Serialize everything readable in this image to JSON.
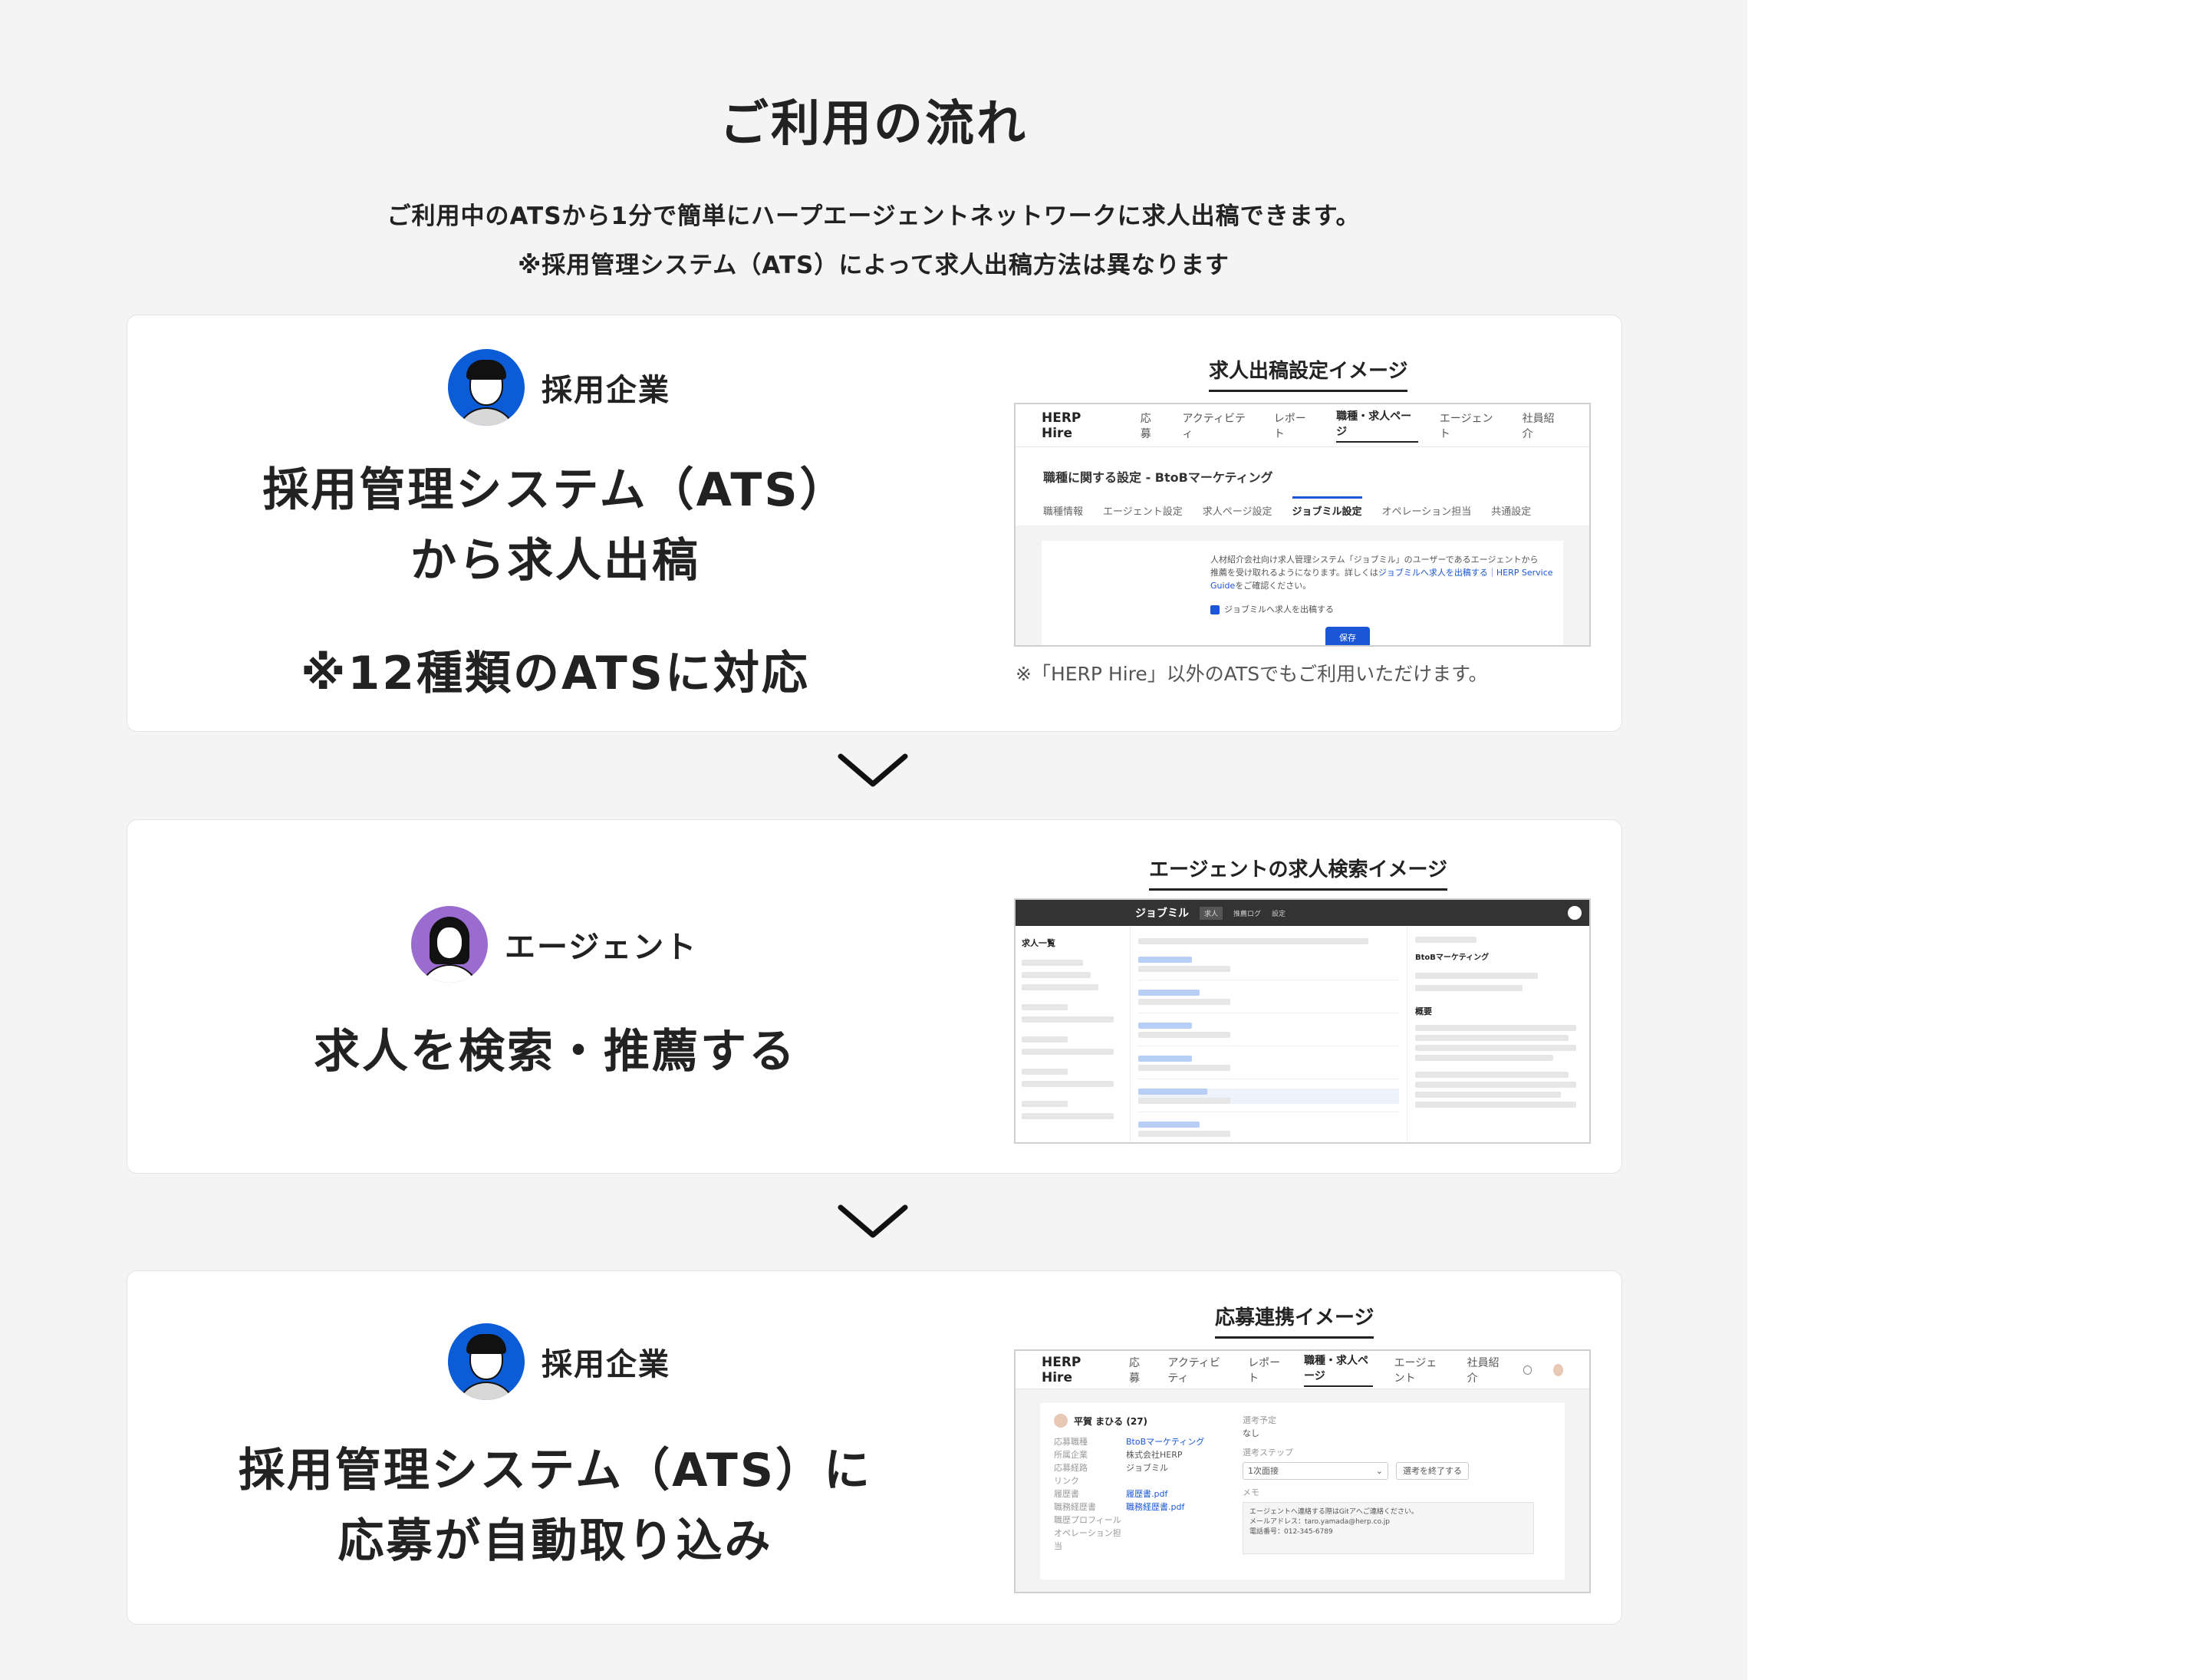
{
  "page": {
    "title": "ご利用の流れ",
    "subtitle_1": "ご利用中のATSから1分で簡単にハープエージェントネットワークに求人出稿できます。",
    "subtitle_2": "※採用管理システム（ATS）によって求人出稿方法は異なります"
  },
  "steps": [
    {
      "role": "採用企業",
      "headline_1": "採用管理システム（ATS）",
      "headline_2": "から求人出稿",
      "note": "※12種類のATSに対応",
      "caption": "求人出稿設定イメージ",
      "footnote": "※「HERP Hire」以外のATSでもご利用いただけます。",
      "screenshot": {
        "logo": "HERP Hire",
        "nav": [
          "応募",
          "アクティビティ",
          "レポート",
          "職種・求人ページ",
          "エージェント",
          "社員紹介"
        ],
        "active_nav": "職種・求人ページ",
        "heading": "職種に関する設定 - BtoBマーケティング",
        "tabs": [
          "職種情報",
          "エージェント設定",
          "求人ページ設定",
          "ジョブミル設定",
          "オペレーション担当",
          "共通設定"
        ],
        "active_tab": "ジョブミル設定",
        "body_1": "人材紹介会社向け求人管理システム「ジョブミル」のユーザーであるエージェントから",
        "body_2": "推薦を受け取れるようになります。詳しくは",
        "body_link": "ジョブミルへ求人を出稿する｜HERP Service Guide",
        "body_3": "をご確認ください。",
        "checkbox_label": "ジョブミルへ求人を出稿する",
        "save_button": "保存"
      }
    },
    {
      "role": "エージェント",
      "headline_1": "求人を検索・推薦する",
      "caption": "エージェントの求人検索イメージ",
      "screenshot": {
        "brand": "ジョブミル",
        "tabs": [
          "求人",
          "推薦ログ",
          "設定"
        ],
        "side_title": "求人一覧",
        "detail_section": "概要",
        "detail_title": "BtoBマーケティング"
      }
    },
    {
      "role": "採用企業",
      "headline_1": "採用管理システム（ATS）に",
      "headline_2": "応募が自動取り込み",
      "caption": "応募連携イメージ",
      "screenshot": {
        "logo": "HERP Hire",
        "nav": [
          "応募",
          "アクティビティ",
          "レポート",
          "職種・求人ページ",
          "エージェント",
          "社員紹介"
        ],
        "active_nav": "職種・求人ページ",
        "candidate": "平賀 まひる (27)",
        "fields": [
          {
            "label": "応募職種",
            "value": "BtoBマーケティング"
          },
          {
            "label": "所属企業",
            "value": "株式会社HERP"
          },
          {
            "label": "応募経路",
            "value": "ジョブミル"
          },
          {
            "label": "リンク",
            "value": ""
          },
          {
            "label": "履歴書",
            "value": "履歴書.pdf"
          },
          {
            "label": "職務経歴書",
            "value": "職務経歴書.pdf"
          },
          {
            "label": "職歴プロフィール",
            "value": ""
          },
          {
            "label": "オペレーション担当",
            "value": ""
          }
        ],
        "right_label_1": "選考予定",
        "right_value_1": "なし",
        "right_label_2": "選考ステップ",
        "select_value": "1次面接",
        "end_button": "選考を終了する",
        "memo_label": "メモ",
        "memo_1": "エージェントへ連絡する際はGitアへご連絡ください。",
        "memo_2": "メールアドレス：taro.yamada@herp.co.jp",
        "memo_3": "電話番号：012-345-6789"
      }
    }
  ]
}
